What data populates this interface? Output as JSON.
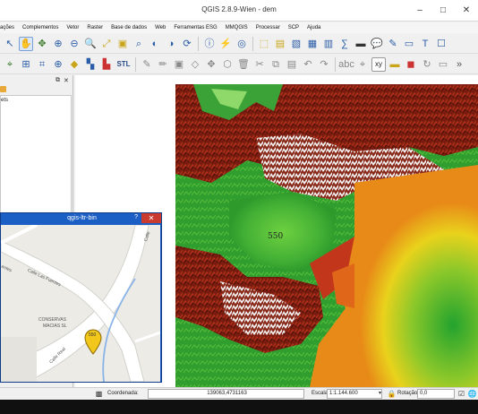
{
  "window": {
    "title": "QGIS 2.8.9-Wien - dem",
    "buttons": {
      "minimize": "–",
      "maximize": "□",
      "close": "✕"
    }
  },
  "menu": [
    "ações",
    "Complementos",
    "Vetor",
    "Raster",
    "Base de dados",
    "Web",
    "Ferramentas ESG",
    "MMQGIS",
    "Processar",
    "SCP",
    "Ajuda"
  ],
  "toolbar2": {
    "stl_label": "STL",
    "xy_label": "xy"
  },
  "layers_panel": {
    "float_btn": "⧉",
    "close_btn": "✕",
    "layer_label": "ets"
  },
  "map": {
    "label_550": "550"
  },
  "popup": {
    "title": "qgis-ltr-bin",
    "help": "?",
    "close": "✕",
    "street_labels": [
      "Calle Las Fuentes",
      "Calle Real",
      "Calle",
      "entes"
    ],
    "place_label_line1": "CONSERVAS",
    "place_label_line2": "MACIAS SL",
    "marker_label": "550"
  },
  "statusbar": {
    "coord_label": "Coordenada:",
    "coord_value": "139063,4731163",
    "scale_label": "Escala",
    "scale_value": "1:1.144.600",
    "rotation_label": "Rotação:",
    "rotation_value": "0,0"
  },
  "colors": {
    "accent": "#1c5fc4",
    "dem_low": "#2f9e2f",
    "dem_mid": "#e7d21f",
    "dem_high": "#7a1a10",
    "dem_peak": "#ffffff",
    "marker": "#f2c61a"
  }
}
